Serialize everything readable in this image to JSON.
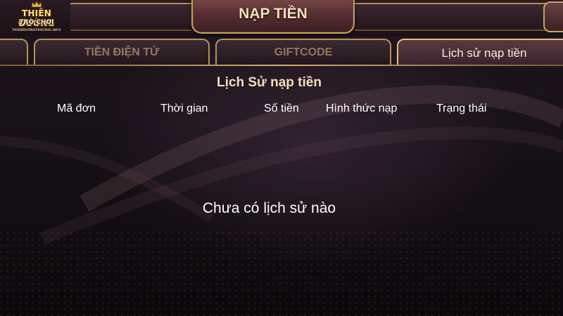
{
  "logo": {
    "line1": "THIÊN ĐƯỜNG",
    "line2": "TRÒ CHƠI",
    "line3": "THIENDUONGTROCHOI.INFO"
  },
  "header": {
    "title": "NẠP TIỀN"
  },
  "tabs": [
    {
      "label": "",
      "active": false
    },
    {
      "label": "TIỀN ĐIỆN TỬ",
      "active": false
    },
    {
      "label": "GIFTCODE",
      "active": false
    },
    {
      "label": "Lịch sử nạp tiền",
      "active": true
    }
  ],
  "history": {
    "title": "Lịch Sử nạp tiền",
    "columns": [
      "Mã đơn",
      "Thời gian",
      "Số tiền",
      "Hình thức nạp",
      "Trạng thái"
    ],
    "empty_message": "Chưa có lịch sử nào"
  },
  "colors": {
    "accent_gold": "#c9a35d",
    "title_text": "#f4e1b4",
    "background": "#171118"
  }
}
